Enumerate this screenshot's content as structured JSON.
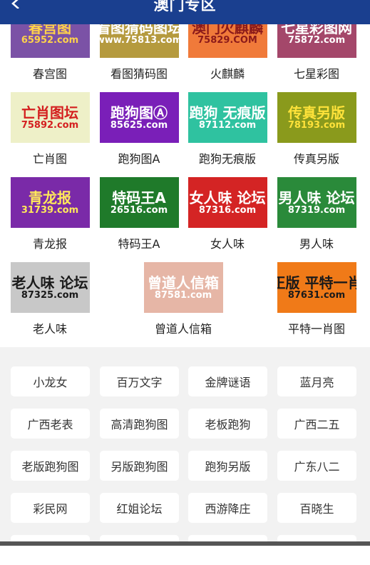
{
  "header": {
    "title": "澳门专区"
  },
  "tiles": [
    {
      "label": "春宫图",
      "img_title": "春宫图",
      "img_sub": "65952.com",
      "bg": "#7b52a6",
      "fg": "#ffd24a"
    },
    {
      "label": "看图猜码图",
      "img_title": "看图猜码图坛",
      "img_sub": "www.75813.com",
      "bg": "#b59a3e",
      "fg": "#ffffff"
    },
    {
      "label": "火麒麟",
      "img_title": "澳门火麒麟",
      "img_sub": "75829.COM",
      "bg": "#f07a3a",
      "fg": "#8b1a1a"
    },
    {
      "label": "七星彩图",
      "img_title": "七星彩图网",
      "img_sub": "75872.com",
      "bg": "#a4476a",
      "fg": "#ffffff"
    },
    {
      "label": "亡肖图",
      "img_title": "亡肖图坛",
      "img_sub": "75892.com",
      "bg": "#eef0c8",
      "fg": "#d42020"
    },
    {
      "label": "跑狗图A",
      "img_title": "跑狗图Ⓐ",
      "img_sub": "85625.com",
      "bg": "#7a1fb8",
      "fg": "#ffffff"
    },
    {
      "label": "跑狗无痕版",
      "img_title": "跑狗 无痕版",
      "img_sub": "87112.com",
      "bg": "#2fc2a0",
      "fg": "#ffffff"
    },
    {
      "label": "传真另版",
      "img_title": "传真另版",
      "img_sub": "78193.com",
      "bg": "#8a9a1c",
      "fg": "#ffe23a"
    },
    {
      "label": "青龙报",
      "img_title": "青龙报",
      "img_sub": "31739.com",
      "bg": "#7a2aa8",
      "fg": "#ffe85a"
    },
    {
      "label": "特码王A",
      "img_title": "特码王A",
      "img_sub": "26516.com",
      "bg": "#1f7a2a",
      "fg": "#ffffff"
    },
    {
      "label": "女人味",
      "img_title": "女人味 论坛",
      "img_sub": "87316.com",
      "bg": "#d42424",
      "fg": "#ffffff"
    },
    {
      "label": "男人味",
      "img_title": "男人味 论坛",
      "img_sub": "87319.com",
      "bg": "#2a8a3a",
      "fg": "#ffffff"
    },
    {
      "label": "老人味",
      "img_title": "老人味 论坛",
      "img_sub": "87325.com",
      "bg": "#c8c8c8",
      "fg": "#1a1a1a"
    },
    {
      "label": "曾道人信箱",
      "img_title": "曾道人信箱",
      "img_sub": "87581.com",
      "bg": "#e6b6a6",
      "fg": "#ffffff"
    },
    {
      "label": "平特一肖图",
      "img_title": "正版 平特一肖",
      "img_sub": "87631.com",
      "bg": "#f07a18",
      "fg": "#1a1a1a"
    }
  ],
  "links": [
    "小龙女",
    "百万文字",
    "金牌谜语",
    "蓝月亮",
    "广西老表",
    "高清跑狗图",
    "老板跑狗",
    "广西二五",
    "老版跑狗图",
    "另版跑狗图",
    "跑狗另版",
    "广东八二",
    "彩民网",
    "红姐论坛",
    "西游降庄",
    "百晓生"
  ]
}
